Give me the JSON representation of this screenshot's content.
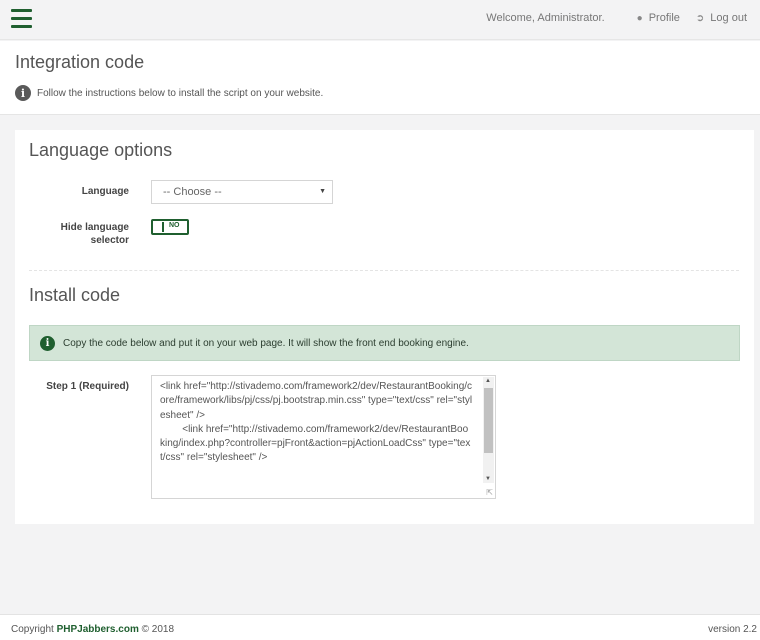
{
  "topbar": {
    "welcome": "Welcome, Administrator.",
    "profile_label": "Profile",
    "logout_label": "Log out"
  },
  "page": {
    "title": "Integration code",
    "info_text": "Follow the instructions below to install the script on your website."
  },
  "language_options": {
    "title": "Language options",
    "language_label": "Language",
    "language_selected": "-- Choose --",
    "hide_selector_label_line1": "Hide language",
    "hide_selector_label_line2": "selector",
    "hide_selector_value": "NO"
  },
  "install_code": {
    "title": "Install code",
    "alert_text": "Copy the code below and put it on your web page. It will show the front end booking engine.",
    "step1_label": "Step 1 (Required)",
    "code": "<link href=\"http://stivademo.com/framework2/dev/RestaurantBooking/core/framework/libs/pj/css/pj.bootstrap.min.css\" type=\"text/css\" rel=\"stylesheet\" />\n        <link href=\"http://stivademo.com/framework2/dev/RestaurantBooking/index.php?controller=pjFront&action=pjActionLoadCss\" type=\"text/css\" rel=\"stylesheet\" />"
  },
  "footer": {
    "copyright_prefix": "Copyright ",
    "brand": "PHPJabbers.com",
    "copyright_suffix": " © 2018",
    "version": "version 2.2"
  },
  "colors": {
    "accent": "#1f5f2f",
    "alert_bg": "#d3e5d7"
  }
}
